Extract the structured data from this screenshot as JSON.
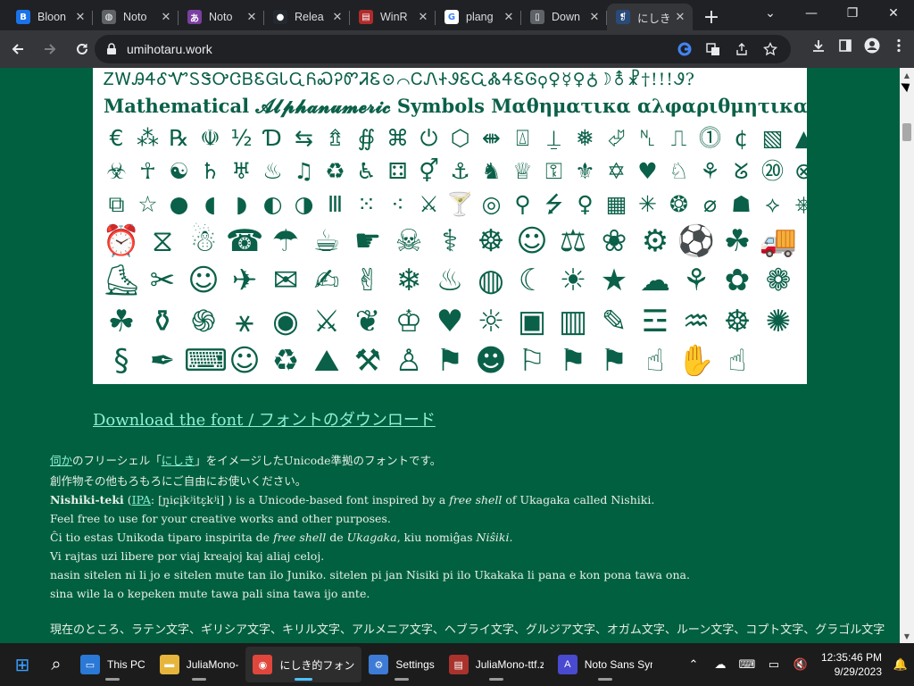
{
  "browser": {
    "tabs": [
      {
        "title": "Bloon",
        "favicon_text": "B",
        "favicon_color": "#1a73e8",
        "active": false
      },
      {
        "title": "Noto",
        "favicon_text": "◍",
        "favicon_color": "#5f6368",
        "active": false
      },
      {
        "title": "Noto",
        "favicon_text": "あ",
        "favicon_color": "#7b3fa0",
        "active": false
      },
      {
        "title": "Relea",
        "favicon_text": "●",
        "favicon_color": "#24292f",
        "active": false
      },
      {
        "title": "WinR",
        "favicon_text": "▤",
        "favicon_color": "#b02b2b",
        "active": false
      },
      {
        "title": "plang",
        "favicon_text": "G",
        "favicon_color": "#ffffff",
        "active": false
      },
      {
        "title": "Down",
        "favicon_text": "▯",
        "favicon_color": "#5f6368",
        "active": false
      },
      {
        "title": "にしき",
        "favicon_text": "❡",
        "favicon_color": "#2a4a7a",
        "active": true
      }
    ],
    "new_tab": "+",
    "address": "umihotaru.work",
    "controls": {
      "minimize": "—",
      "maximize": "❐",
      "close": "✕",
      "tab_search": "⌄"
    }
  },
  "page": {
    "font_preview": {
      "line1": "ᏃᎳᎯᏎᎴᏉᏚᏕᎤᏣᏴᏋᏀᏓᏩᏲᏍᎮᏛᏘᏋ⊙⌒ᏟᏁᏐᏭᏋᏩᏜᏎᏋᎶ⚲♀☿♀♁☽⚨☧†!!!Ꮽ?",
      "line2": "Mathematical 𝓐𝓵𝓹𝓱𝓪𝓷𝓾𝓶𝓮𝓻𝓲𝓬 Symbols Μαθηματικα αλφαριθμητικα",
      "rows": [
        [
          "€",
          "⁂",
          "℞",
          "☫",
          "½",
          "Ɗ",
          "⇆",
          "⇯",
          "∯",
          "⌘",
          "⏻",
          "⬡",
          "⇼",
          "⍍",
          "⍊",
          "❅",
          "⮰",
          "␤",
          "⎍",
          "⓵",
          "¢",
          "▧",
          "▲",
          "◷",
          "§",
          "☈",
          "☑",
          "♣"
        ],
        [
          "☣",
          "☥",
          "☯",
          "♄",
          "♅",
          "♨",
          "♫",
          "♻",
          "♿",
          "⚃",
          "⚥",
          "⚓",
          "♞",
          "♕",
          "⚿",
          "⚜",
          "✡",
          "♥",
          "♘",
          "⚘",
          "ᘜ",
          "⑳",
          "⊗",
          "☰",
          "◆",
          "⫶"
        ],
        [
          "⧉",
          "☆",
          "●",
          "◖",
          "◗",
          "◐",
          "◑",
          "Ⅲ",
          "⁙",
          "⁖",
          "⚔",
          "🍸",
          "◎",
          "⚲",
          "⭍",
          "♀",
          "▦",
          "✳",
          "❂",
          "⌀",
          "☗",
          "⟡",
          "⎈",
          "🆘"
        ],
        [
          "⏰",
          "⧖",
          "☃",
          "☎",
          "☂",
          "☕",
          "☛",
          "☠",
          "⚕",
          "☸",
          "☺",
          "⚖",
          "❀",
          "⚙",
          "⚽",
          "☘",
          "🚚"
        ],
        [
          "⛸",
          "✂",
          "☺",
          "✈",
          "✉",
          "✍",
          "✌",
          "❄",
          "♨",
          "◍",
          "☾",
          "☀",
          "★",
          "☁",
          "⚘",
          "✿",
          "❁"
        ],
        [
          "☘",
          "⚱",
          "֍",
          "⚹",
          "◉",
          "⚔",
          "❦",
          "♔",
          "♥",
          "☼",
          "▣",
          "▥",
          "✎",
          "☲",
          "♒",
          "☸",
          "✺"
        ],
        [
          "§",
          "✒",
          "⌨",
          "☺",
          "♻",
          "⛰",
          "⚒",
          "♙",
          "⚑",
          "☻",
          "⚐",
          "⚑",
          "⚑",
          "☝",
          "✋",
          "☝"
        ]
      ]
    },
    "download_link": "Download the font / フォントのダウンロード",
    "p1_link": "伺か",
    "p1_mid": "のフリーシェル「",
    "p1_link2": "にしき",
    "p1_end": "」をイメージしたUnicode準拠のフォントです。",
    "p2": "創作物その他もろもろにご自由にお使いください。",
    "p3_bold": "Nishiki-teki",
    "p3_paren_open": " (",
    "p3_link": "IPA",
    "p3_ipa": ": [ɲ̟iɕi̥kʲitɛ̞kʲi] ) is a Unicode-based font inspired by a ",
    "p3_em": "free shell",
    "p3_end": " of Ukagaka called Nishiki.",
    "p4": "Feel free to use for your creative works and other purposes.",
    "p5_a": "Ĉi tio estas Unikoda tiparo inspirita de ",
    "p5_em1": "free shell",
    "p5_b": " de ",
    "p5_em2": "Ukagaka",
    "p5_c": ", kiu nomiĝas ",
    "p5_em3": "Niŝiki",
    "p5_d": ".",
    "p6": "Vi rajtas uzi libere por viaj kreajoj kaj aliaj celoj.",
    "p7": "nasin sitelen ni li jo e sitelen mute tan ilo Juniko. sitelen pi jan Nisiki pi ilo Ukakaka li pana e kon pona tawa ona.",
    "p8": "sina wile la o kepeken mute tawa pali sina tawa ijo ante.",
    "p9": "現在のところ、ラテン文字、ギリシア文字、キリル文字、アルメニア文字、ヘブライ文字、グルジア文字、オガム文字、ルーン文字、コプト文字、グラゴル文字"
  },
  "taskbar": {
    "items": [
      {
        "label": "",
        "icon": "start-icon",
        "glyph": "⊞",
        "color": "#3aa0ff"
      },
      {
        "label": "",
        "icon": "search-icon",
        "glyph": "⌕",
        "color": "transparent"
      },
      {
        "label": "This PC",
        "icon": "computer-icon",
        "glyph": "▭",
        "color": "#2b79d6"
      },
      {
        "label": "JuliaMono-",
        "icon": "folder-icon",
        "glyph": "▬",
        "color": "#e7b53c"
      },
      {
        "label": "にしき的フォント -",
        "icon": "chrome-icon",
        "glyph": "◉",
        "color": "#e0463c",
        "active": true
      },
      {
        "label": "Settings",
        "icon": "gear-icon",
        "glyph": "⚙",
        "color": "#3d7bd6"
      },
      {
        "label": "JuliaMono-ttf.zi",
        "icon": "winrar-icon",
        "glyph": "▤",
        "color": "#a9332c"
      },
      {
        "label": "Noto Sans Sym",
        "icon": "font-icon",
        "glyph": "A",
        "color": "#4a4ad0"
      }
    ],
    "time": "12:35:46 PM",
    "date": "9/29/2023"
  }
}
